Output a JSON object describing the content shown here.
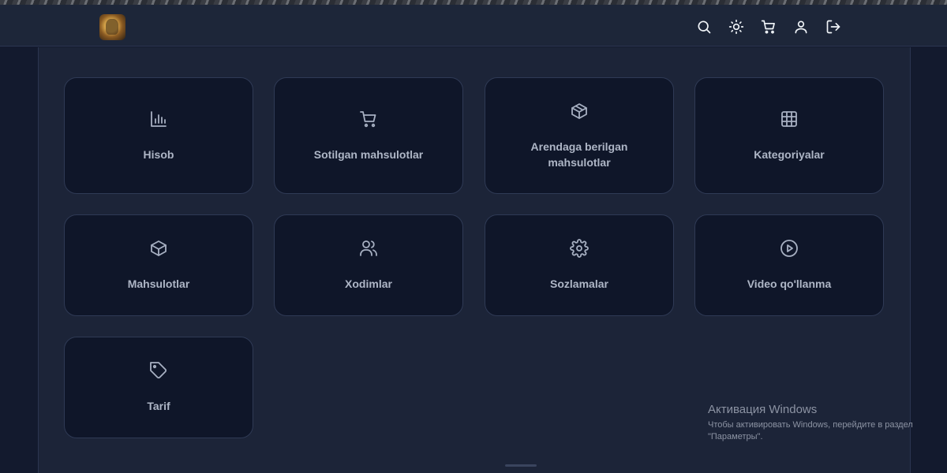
{
  "header": {
    "logo_alt": "logo",
    "actions": [
      {
        "name": "search-icon"
      },
      {
        "name": "theme-sun-icon"
      },
      {
        "name": "cart-icon"
      },
      {
        "name": "user-icon"
      },
      {
        "name": "logout-icon"
      }
    ]
  },
  "menu": {
    "items": [
      {
        "label": "Hisob",
        "icon": "bar-chart-icon"
      },
      {
        "label": "Sotilgan mahsulotlar",
        "icon": "cart-icon"
      },
      {
        "label": "Arendaga berilgan mahsulotlar",
        "icon": "box-icon"
      },
      {
        "label": "Kategoriyalar",
        "icon": "grid-icon"
      },
      {
        "label": "Mahsulotlar",
        "icon": "box-icon"
      },
      {
        "label": "Xodimlar",
        "icon": "users-icon"
      },
      {
        "label": "Sozlamalar",
        "icon": "gear-icon"
      },
      {
        "label": "Video qo'llanma",
        "icon": "play-circle-icon"
      },
      {
        "label": "Tarif",
        "icon": "tag-icon"
      }
    ]
  },
  "watermark": {
    "title": "Активация Windows",
    "text": "Чтобы активировать Windows, перейдите в раздел \"Параметры\"."
  }
}
